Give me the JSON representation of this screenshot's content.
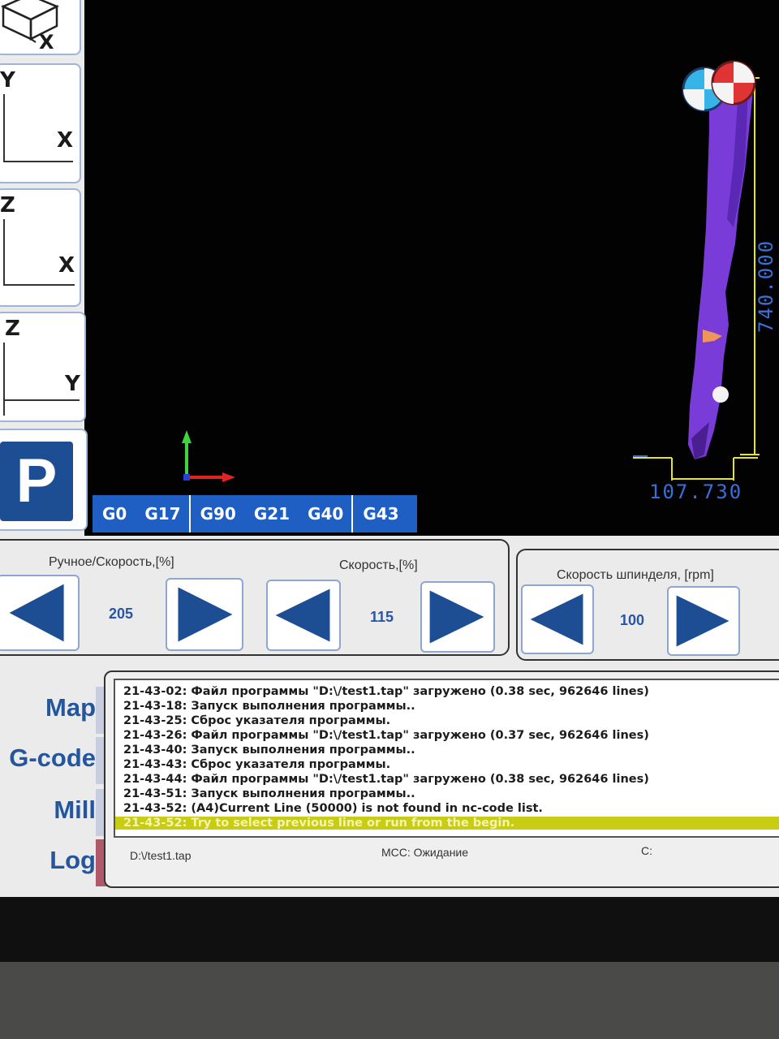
{
  "views": {
    "iso_axis": "X",
    "xy": {
      "vertical": "Y",
      "horizontal": "X"
    },
    "zx": {
      "vertical": "Z",
      "horizontal": "X"
    },
    "zy": {
      "vertical": "Z",
      "horizontal": "Y"
    },
    "park_label": "P"
  },
  "viewport": {
    "dimension_vertical": "740.000",
    "dimension_horizontal": "107.730",
    "colors": {
      "toolpath": "#7a3cd8",
      "dimension": "#e6e61e",
      "dimension_text": "#3a6fd8"
    }
  },
  "gcodes": [
    "G0",
    "G17",
    "G90",
    "G21",
    "G40",
    "G43"
  ],
  "controls": {
    "manual_speed": {
      "label": "Ручное/Скорость,[%]",
      "value": "205"
    },
    "feed_speed": {
      "label": "Скорость,[%]",
      "value": "115"
    },
    "spindle_speed": {
      "label": "Скорость шпинделя, [rpm]",
      "value": "100"
    }
  },
  "nav": {
    "items": [
      "Map",
      "G-code",
      "Mill",
      "Log"
    ],
    "active": "Log"
  },
  "log": {
    "lines": [
      "21-43-02: Файл программы \"D:\\/test1.tap\" загружено (0.38 sec, 962646 lines)",
      "21-43-18: Запуск выполнения программы..",
      "21-43-25: Сброс указателя программы.",
      "21-43-26: Файл программы \"D:\\/test1.tap\" загружено (0.37 sec, 962646 lines)",
      "21-43-40: Запуск выполнения программы..",
      "21-43-43: Сброс указателя программы.",
      "21-43-44: Файл программы \"D:\\/test1.tap\" загружено (0.38 sec, 962646 lines)",
      "21-43-51: Запуск выполнения программы..",
      "21-43-52: (A4)Current Line (50000) is not found in nc-code list.",
      "21-43-52: Try to select previous line or run from the begin."
    ],
    "highlight_color": "#c8cc12"
  },
  "status_bar": {
    "file": "D:\\/test1.tap",
    "mcc": "MCC:  Ожидание",
    "c": "C:"
  }
}
